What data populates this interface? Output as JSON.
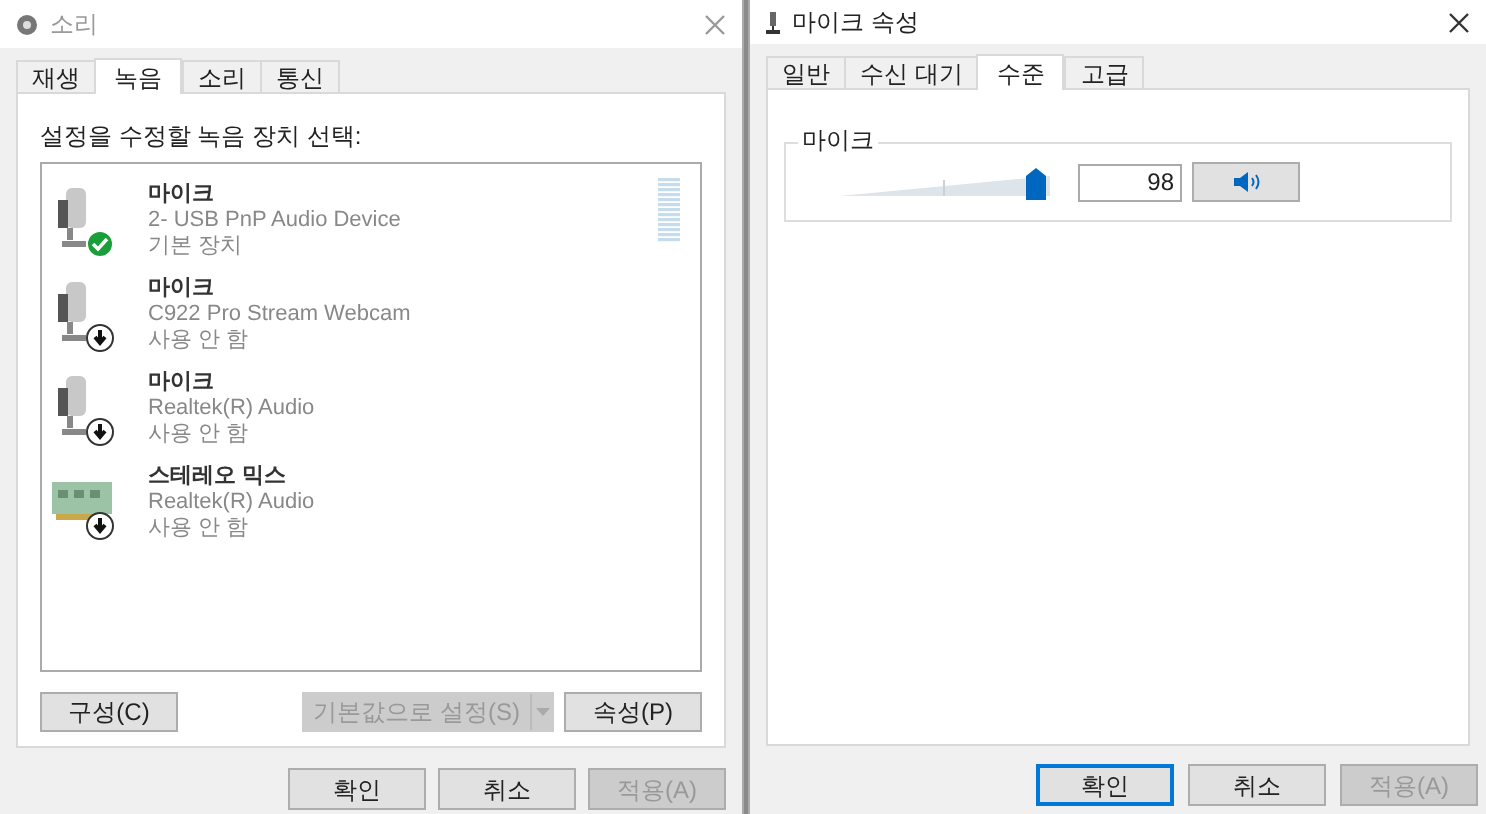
{
  "sound_window": {
    "title": "소리",
    "tabs": [
      {
        "label": "재생",
        "selected": false
      },
      {
        "label": "녹음",
        "selected": true
      },
      {
        "label": "소리",
        "selected": false
      },
      {
        "label": "통신",
        "selected": false
      }
    ],
    "instruction": "설정을 수정할 녹음 장치 선택:",
    "devices": [
      {
        "kind": "mic",
        "name": "마이크",
        "description": "2- USB PnP Audio Device",
        "status": "기본 장치",
        "is_default": true
      },
      {
        "kind": "mic",
        "name": "마이크",
        "description": "C922 Pro Stream Webcam",
        "status": "사용 안 함",
        "is_default": false
      },
      {
        "kind": "mic",
        "name": "마이크",
        "description": "Realtek(R) Audio",
        "status": "사용 안 함",
        "is_default": false
      },
      {
        "kind": "card",
        "name": "스테레오 믹스",
        "description": "Realtek(R) Audio",
        "status": "사용 안 함",
        "is_default": false
      }
    ],
    "configure_button": {
      "label": "구성(C)",
      "disabled": false
    },
    "set_default_button": {
      "label": "기본값으로 설정(S)",
      "disabled": true
    },
    "properties_button": {
      "label": "속성(P)",
      "disabled": false
    },
    "buttons": [
      {
        "label": "확인",
        "disabled": false,
        "default": false
      },
      {
        "label": "취소",
        "disabled": false,
        "default": false
      },
      {
        "label": "적용(A)",
        "disabled": true,
        "default": false
      }
    ]
  },
  "properties_window": {
    "title": "마이크 속성",
    "tabs": [
      {
        "label": "일반",
        "selected": false
      },
      {
        "label": "수신 대기",
        "selected": false
      },
      {
        "label": "수준",
        "selected": true
      },
      {
        "label": "고급",
        "selected": false
      }
    ],
    "group_label": "마이크",
    "slider": {
      "level": 0.98
    },
    "value": "98",
    "muted": false,
    "buttons": [
      {
        "label": "확인",
        "disabled": false,
        "default": true
      },
      {
        "label": "취소",
        "disabled": false,
        "default": false
      },
      {
        "label": "적용(A)",
        "disabled": true,
        "default": false
      }
    ]
  }
}
